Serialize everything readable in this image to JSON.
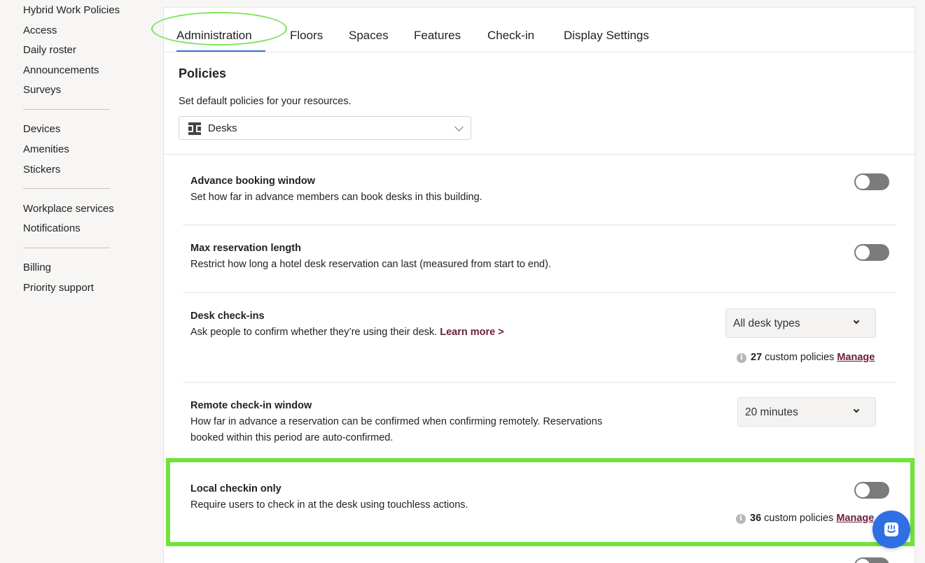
{
  "sidebar": {
    "items": [
      {
        "label": "Hybrid Work Policies"
      },
      {
        "label": "Access"
      },
      {
        "label": "Daily roster"
      },
      {
        "label": "Announcements"
      },
      {
        "label": "Surveys"
      },
      {
        "label": "Devices"
      },
      {
        "label": "Amenities"
      },
      {
        "label": "Stickers"
      },
      {
        "label": "Workplace services"
      },
      {
        "label": "Notifications"
      },
      {
        "label": "Billing"
      },
      {
        "label": "Priority support"
      }
    ]
  },
  "tabs": [
    {
      "label": "Administration",
      "active": true
    },
    {
      "label": "Floors"
    },
    {
      "label": "Spaces"
    },
    {
      "label": "Features"
    },
    {
      "label": "Check-in"
    },
    {
      "label": "Display Settings"
    }
  ],
  "policies_section": {
    "title": "Policies",
    "subtitle": "Set default policies for your resources.",
    "resource_select": {
      "value": "Desks",
      "icon": "desk-icon"
    }
  },
  "policies": {
    "advance_booking": {
      "title": "Advance booking window",
      "description": "Set how far in advance members can book desks in this building.",
      "enabled": false
    },
    "max_reservation": {
      "title": "Max reservation length",
      "description": "Restrict how long a hotel desk reservation can last (measured from start to end).",
      "enabled": false
    },
    "desk_checkins": {
      "title": "Desk check-ins",
      "description": "Ask people to confirm whether they’re using their desk.",
      "learn_more": "Learn more >",
      "dropdown_value": "All desk types",
      "custom_count": "27",
      "custom_label": "custom policies",
      "manage_label": "Manage"
    },
    "remote_checkin": {
      "title": "Remote check-in window",
      "description_line1": "How far in advance a reservation can be confirmed when confirming remotely. Reservations",
      "description_line2": "booked within this period are auto-confirmed.",
      "dropdown_value": "20 minutes"
    },
    "local_checkin": {
      "title": "Local checkin only",
      "description": "Require users to check in at the desk using touchless actions.",
      "enabled": false,
      "custom_count": "36",
      "custom_label": "custom policies",
      "manage_label": "Manage"
    }
  },
  "colors": {
    "link": "#6a1e3c",
    "annotation": "#6fe33a",
    "tab_underline": "#3a6fd8",
    "chat_button": "#2f6fe4"
  }
}
